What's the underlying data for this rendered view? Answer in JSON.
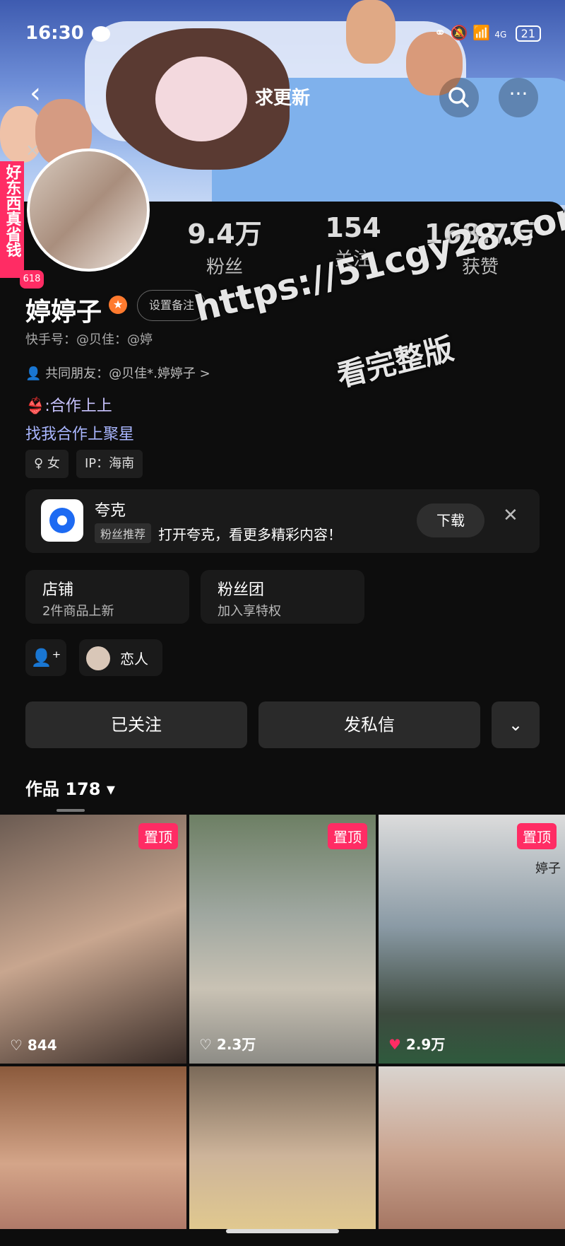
{
  "status_bar": {
    "time": "16:30",
    "battery": "21",
    "signal": "4G"
  },
  "nav": {
    "title": "求更新"
  },
  "side_promo": {
    "text": "好东西真省钱",
    "badge": "618"
  },
  "stats": [
    {
      "num": "9.4万",
      "label": "粉丝"
    },
    {
      "num": "154",
      "label": "关注"
    },
    {
      "num": "168.7万",
      "label": "获赞"
    }
  ],
  "profile": {
    "name": "婷婷子",
    "note_button": "设置备注",
    "kuaishou_id": "快手号：@贝佳：@婷",
    "mutual_friends": "共同朋友：@贝佳*.婷婷子 >",
    "bio_line1": "👙:合作上上",
    "bio_line2": "找我合作上聚星"
  },
  "tags": [
    "♀ 女",
    "IP：海南"
  ],
  "ad": {
    "title": "夸克",
    "chip": "粉丝推荐",
    "text": "打开夸克，看更多精彩内容！",
    "download": "下载"
  },
  "cards": [
    {
      "title": "店铺",
      "sub": "2件商品上新"
    },
    {
      "title": "粉丝团",
      "sub": "加入享特权"
    }
  ],
  "lover": {
    "label": "恋人"
  },
  "actions": {
    "followed": "已关注",
    "message": "发私信"
  },
  "works": {
    "label": "作品 178"
  },
  "posts": [
    {
      "pinned": "置顶",
      "likes": "844",
      "liked": false
    },
    {
      "pinned": "置顶",
      "likes": "2.3万",
      "liked": false
    },
    {
      "pinned": "置顶",
      "likes": "2.9万",
      "liked": true,
      "overlay_text": "婷子"
    }
  ],
  "watermark": {
    "line1": "https://51cgy28.com",
    "line2": "看完整版"
  },
  "colors": {
    "accent": "#ff2c64",
    "verify": "#ff7a2e",
    "bio": "#a9b6ff"
  }
}
